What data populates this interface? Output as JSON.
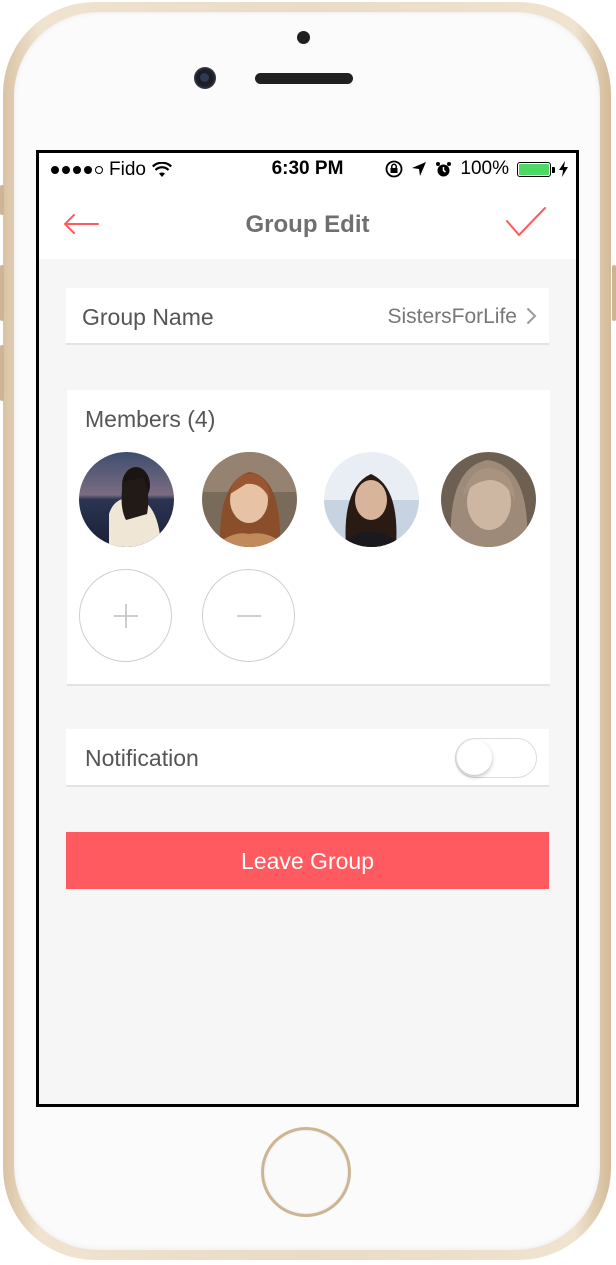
{
  "status_bar": {
    "carrier": "Fido",
    "time": "6:30 PM",
    "battery": "100%"
  },
  "navbar": {
    "title": "Group Edit",
    "back_icon": "arrow-left-icon",
    "done_icon": "checkmark-icon"
  },
  "group_name": {
    "label": "Group Name",
    "value": "SistersForLife"
  },
  "members": {
    "title": "Members (4)",
    "avatars": [
      "member-1",
      "member-2",
      "member-3",
      "member-4"
    ],
    "add_icon": "plus-icon",
    "remove_icon": "minus-icon"
  },
  "notification": {
    "label": "Notification",
    "enabled": false
  },
  "leave_button": "Leave Group",
  "colors": {
    "accent": "#ff5a5f",
    "background": "#f6f6f6",
    "battery": "#4cd964"
  }
}
